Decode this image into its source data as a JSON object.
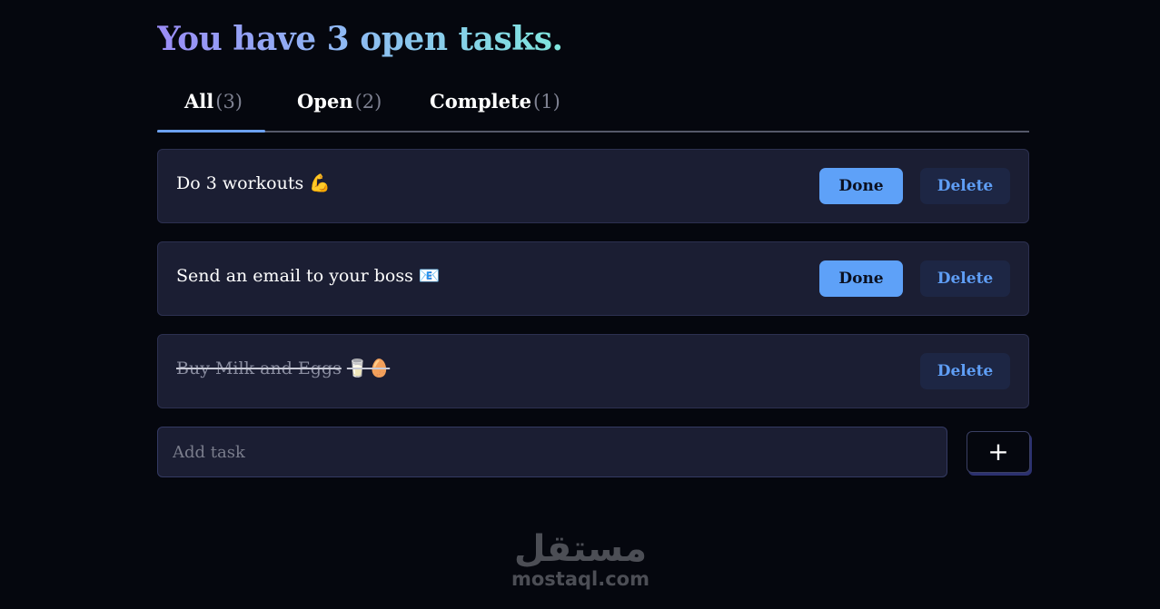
{
  "header": {
    "title": "You have 3 open tasks."
  },
  "tabs": [
    {
      "label": "All",
      "count": "(3)",
      "active": true
    },
    {
      "label": "Open",
      "count": "(2)",
      "active": false
    },
    {
      "label": "Complete",
      "count": "(1)",
      "active": false
    }
  ],
  "tasks": [
    {
      "text": "Do 3 workouts",
      "emoji": "💪",
      "done_label": "Done",
      "delete_label": "Delete",
      "completed": false
    },
    {
      "text": "Send an email to your boss",
      "emoji": "📧",
      "done_label": "Done",
      "delete_label": "Delete",
      "completed": false
    },
    {
      "text": "Buy Milk and Eggs",
      "emoji": "🥛🥚",
      "delete_label": "Delete",
      "completed": true
    }
  ],
  "add_task": {
    "placeholder": "Add task",
    "button_label": "+"
  },
  "watermark": {
    "logo": "مستقل",
    "text": "mostaql.com"
  },
  "colors": {
    "background": "#05070e",
    "card": "#1b1e33",
    "accent": "#5ea1f8",
    "tab_underline": "#6ca1f0",
    "title_gradient": [
      "#9a8cf6",
      "#8fb8f4",
      "#7fe6dd"
    ]
  }
}
